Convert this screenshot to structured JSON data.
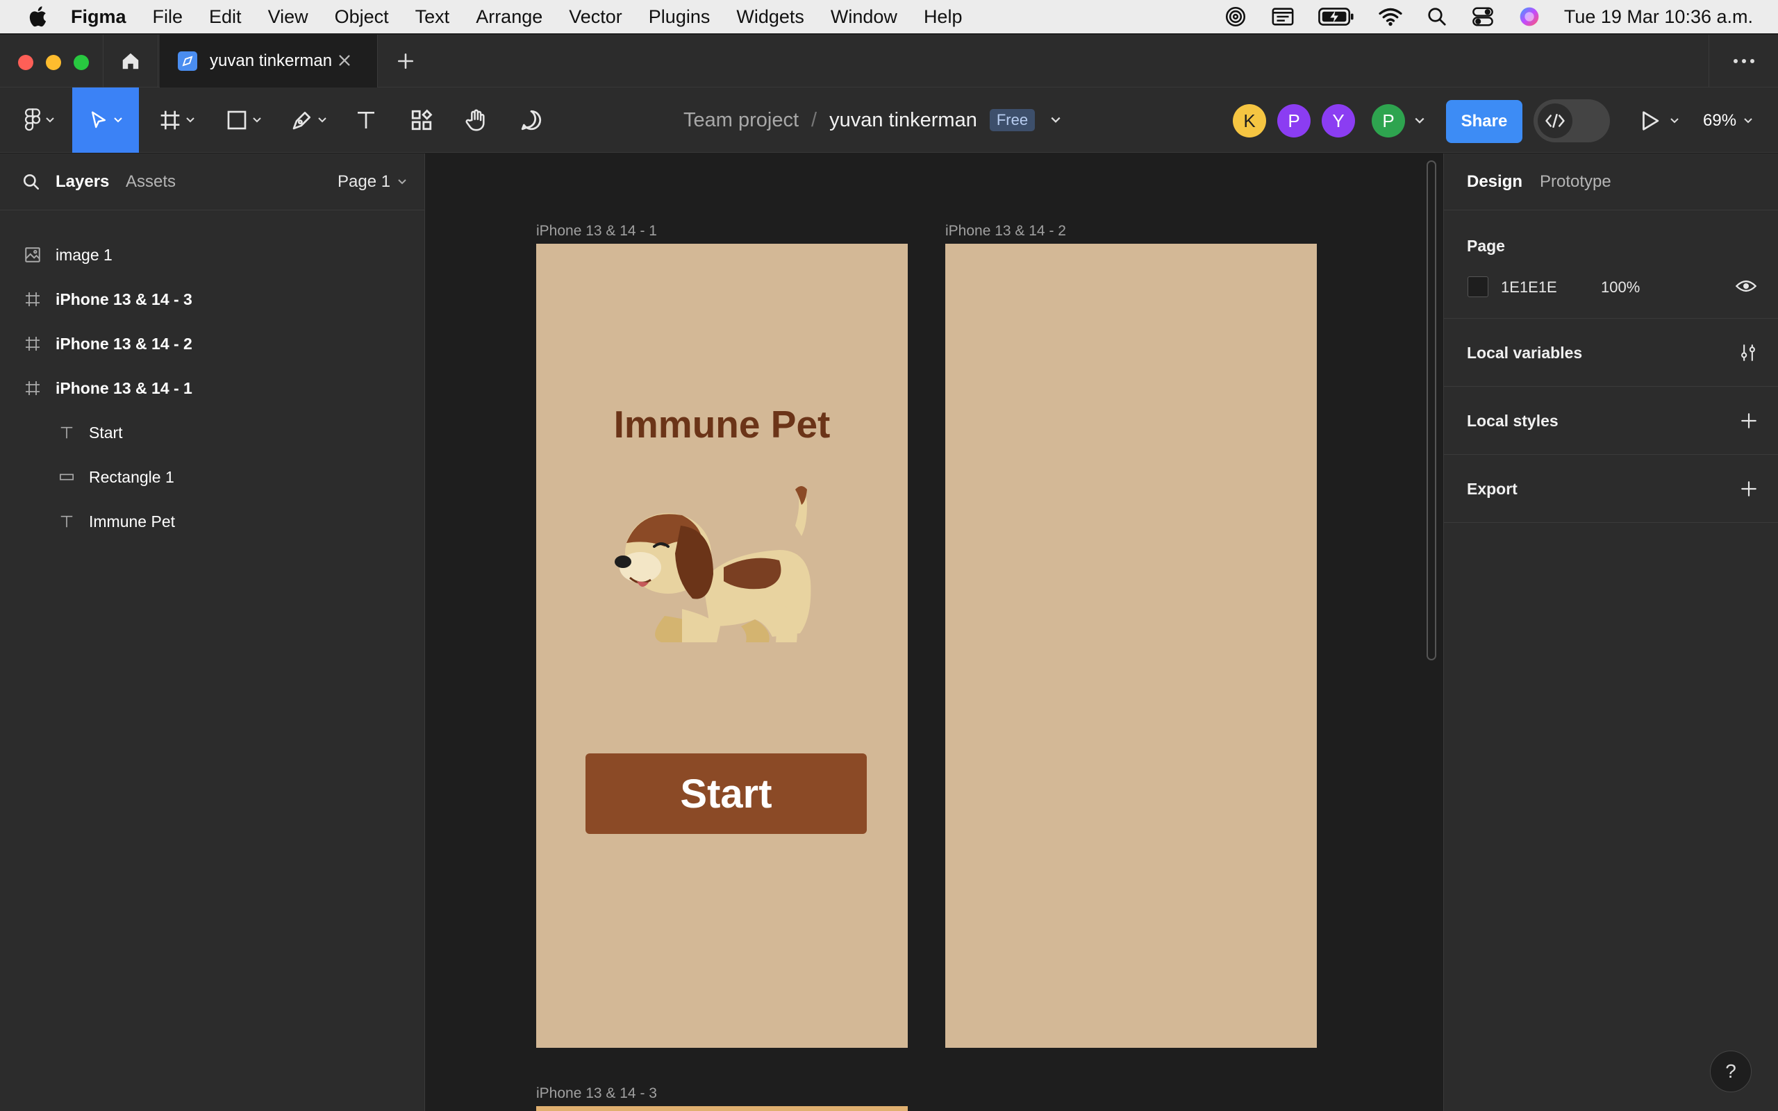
{
  "menubar": {
    "items": [
      "Figma",
      "File",
      "Edit",
      "View",
      "Object",
      "Text",
      "Arrange",
      "Vector",
      "Plugins",
      "Widgets",
      "Window",
      "Help"
    ],
    "clock": "Tue 19 Mar  10:36 a.m.",
    "status_icons": [
      "airdrop-icon",
      "screen-icon",
      "battery-charging-icon",
      "wifi-icon",
      "spotlight-icon",
      "control-center-icon",
      "siri-icon"
    ]
  },
  "tabbar": {
    "file_tab_title": "yuvan tinkerman"
  },
  "toolbar": {
    "team": "Team project",
    "separator": "/",
    "file_name": "yuvan tinkerman",
    "plan_badge": "Free",
    "avatars": [
      {
        "initial": "K",
        "color": "#f5c542",
        "text_color": "#1e1e1e"
      },
      {
        "initial": "P",
        "color": "#8b3df2",
        "text_color": "#ffffff"
      },
      {
        "initial": "Y",
        "color": "#8b3df2",
        "text_color": "#ffffff"
      },
      {
        "initial": "P",
        "color": "#2ea44f",
        "text_color": "#ffffff"
      }
    ],
    "share_label": "Share",
    "zoom": "69%",
    "accent": "#3b82f6"
  },
  "left_panel": {
    "tab_layers": "Layers",
    "tab_assets": "Assets",
    "page": "Page 1",
    "layers": [
      {
        "name": "image 1",
        "icon": "image-icon",
        "bold": false
      },
      {
        "name": "iPhone 13 & 14 - 3",
        "icon": "frame-icon",
        "bold": true
      },
      {
        "name": "iPhone 13 & 14 - 2",
        "icon": "frame-icon",
        "bold": true
      },
      {
        "name": "iPhone 13 & 14 - 1",
        "icon": "frame-icon",
        "bold": true
      },
      {
        "name": "Start",
        "icon": "text-icon",
        "bold": false
      },
      {
        "name": "Rectangle 1",
        "icon": "rectangle-icon",
        "bold": false
      },
      {
        "name": "Immune Pet",
        "icon": "text-icon",
        "bold": false
      }
    ]
  },
  "canvas": {
    "frames": [
      {
        "label": "iPhone 13 & 14 - 1"
      },
      {
        "label": "iPhone 13 & 14 - 2"
      },
      {
        "label": "iPhone 13 & 14 - 3"
      }
    ],
    "frame1_title": "Immune Pet",
    "frame1_button": "Start",
    "frame_fill": "#d3b896"
  },
  "right_panel": {
    "tab_design": "Design",
    "tab_prototype": "Prototype",
    "page_section": "Page",
    "page_color_hex": "1E1E1E",
    "page_opacity": "100%",
    "local_variables": "Local variables",
    "local_styles": "Local styles",
    "export": "Export"
  },
  "help": "?"
}
